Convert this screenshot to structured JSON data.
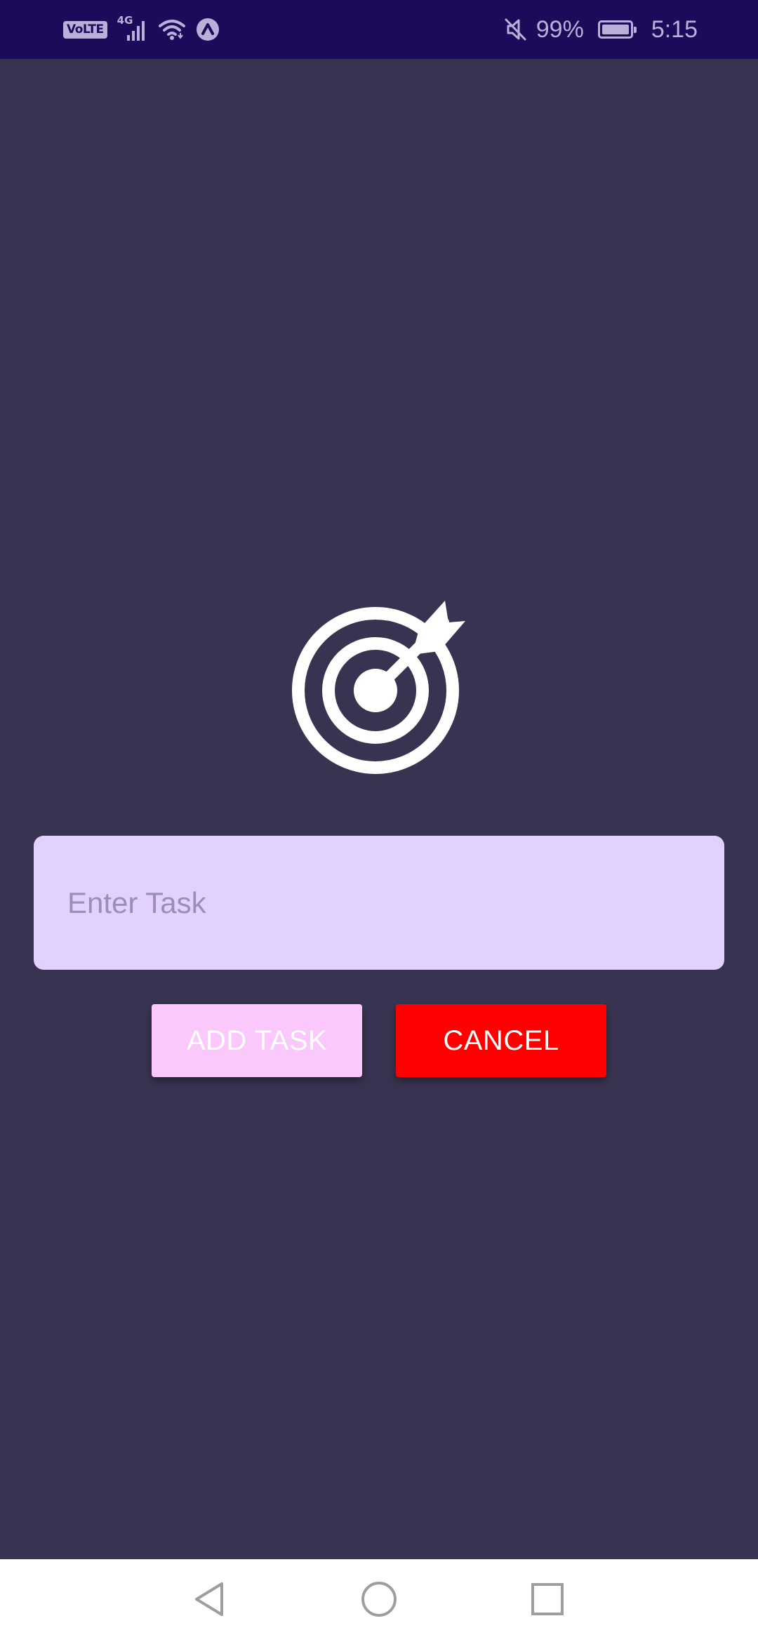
{
  "status_bar": {
    "volte": "VoLTE",
    "network": "4G",
    "battery_percent": "99%",
    "time": "5:15",
    "icons": [
      "volte-icon",
      "signal-icon",
      "wifi-icon",
      "app-notification-icon",
      "mute-icon",
      "battery-icon"
    ]
  },
  "logo": {
    "icon": "target-arrow-icon"
  },
  "task_input": {
    "placeholder": "Enter Task",
    "value": ""
  },
  "buttons": {
    "add_label": "ADD TASK",
    "cancel_label": "CANCEL"
  },
  "nav_bar": {
    "icons": [
      "back-icon",
      "home-icon",
      "recents-icon"
    ]
  },
  "colors": {
    "background": "#383350",
    "status_bar": "#1e0a5a",
    "input_background": "#e2d0ff",
    "add_button": "#fbc8fb",
    "cancel_button": "#ff0000",
    "nav_bar": "#ffffff"
  }
}
